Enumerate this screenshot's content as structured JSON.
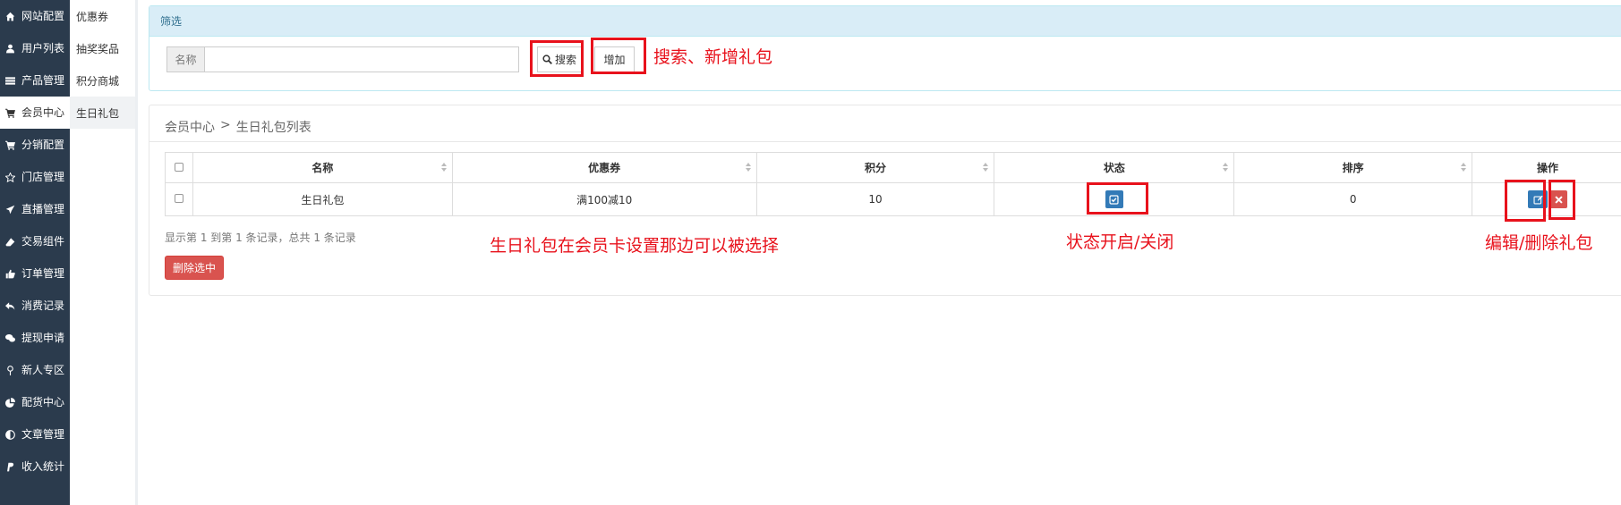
{
  "sidebar": {
    "items": [
      {
        "label": "网站配置",
        "icon": "home-icon"
      },
      {
        "label": "用户列表",
        "icon": "user-icon"
      },
      {
        "label": "产品管理",
        "icon": "list-icon"
      },
      {
        "label": "会员中心",
        "icon": "cart-icon",
        "active": true
      },
      {
        "label": "分销配置",
        "icon": "cart-icon"
      },
      {
        "label": "门店管理",
        "icon": "star-icon"
      },
      {
        "label": "直播管理",
        "icon": "plane-icon"
      },
      {
        "label": "交易组件",
        "icon": "eraser-icon"
      },
      {
        "label": "订单管理",
        "icon": "thumbs-up-icon"
      },
      {
        "label": "消费记录",
        "icon": "reply-icon"
      },
      {
        "label": "提现申请",
        "icon": "chat-icon"
      },
      {
        "label": "新人专区",
        "icon": "map-pin-icon"
      },
      {
        "label": "配货中心",
        "icon": "pie-chart-icon"
      },
      {
        "label": "文章管理",
        "icon": "adjust-icon"
      },
      {
        "label": "收入统计",
        "icon": "paypal-icon"
      }
    ]
  },
  "submenu": {
    "items": [
      {
        "label": "优惠券"
      },
      {
        "label": "抽奖奖品"
      },
      {
        "label": "积分商城"
      },
      {
        "label": "生日礼包",
        "active": true
      }
    ]
  },
  "filter": {
    "title": "筛选",
    "name_label": "名称",
    "name_value": "",
    "search_label": "搜索",
    "add_label": "增加"
  },
  "list": {
    "breadcrumb": {
      "parent": "会员中心",
      "separator": ">",
      "current": "生日礼包列表"
    },
    "columns": [
      "名称",
      "优惠券",
      "积分",
      "状态",
      "排序",
      "操作"
    ],
    "rows": [
      {
        "name": "生日礼包",
        "coupon": "满100减10",
        "points": "10",
        "sort": "0",
        "status_enabled": true
      }
    ],
    "pager_info": "显示第 1 到第 1 条记录，总共 1 条记录",
    "delete_selected_label": "删除选中"
  },
  "annotations": {
    "search_add": "搜索、新增礼包",
    "member_card": "生日礼包在会员卡设置那边可以被选择",
    "status_toggle": "状态开启/关闭",
    "edit_delete": "编辑/删除礼包",
    "color": "#e8121c"
  },
  "colors": {
    "sidebar_bg": "#2b3b4d",
    "primary": "#337ab7",
    "danger": "#d9534f",
    "info_header": "#d9edf7"
  }
}
